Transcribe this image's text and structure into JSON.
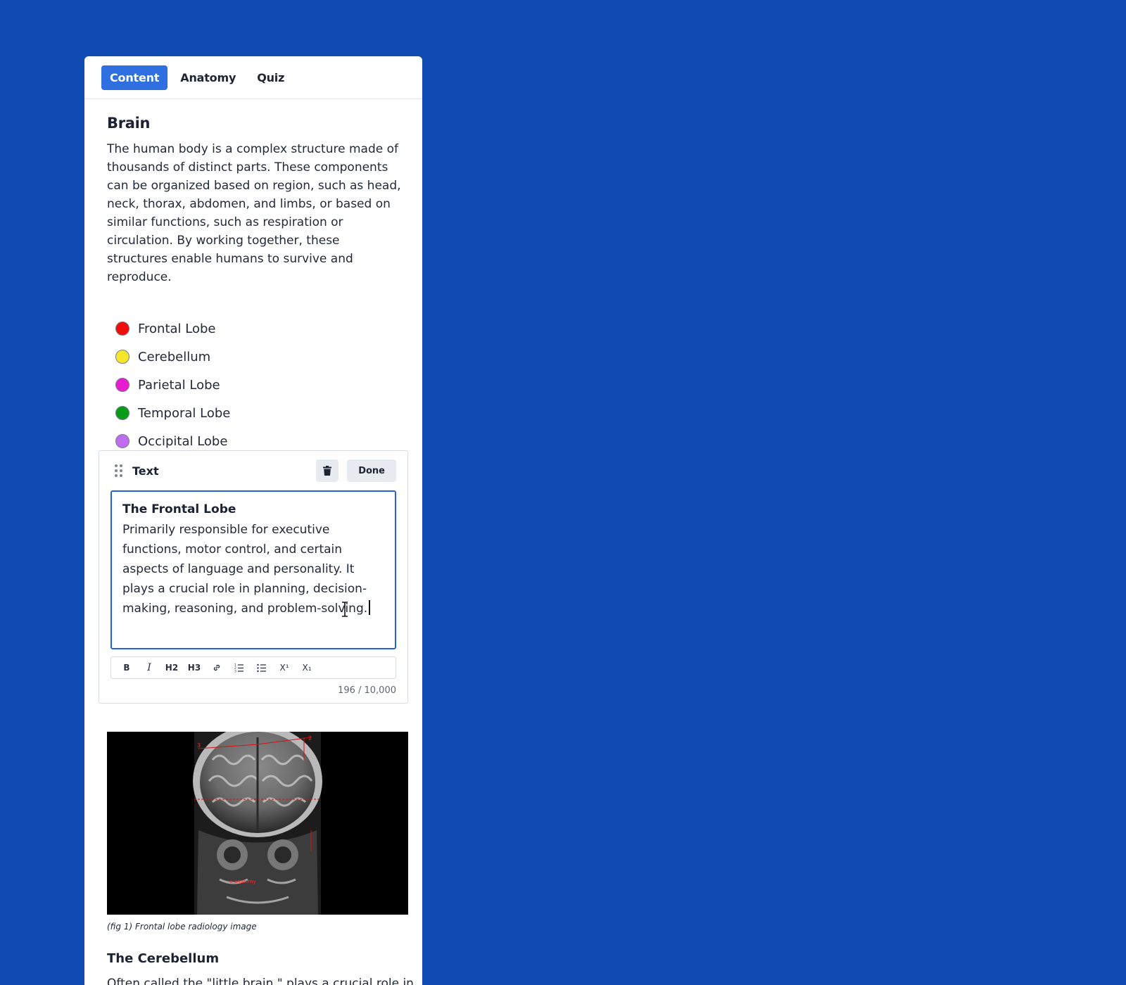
{
  "tabs": [
    {
      "label": "Content",
      "active": true
    },
    {
      "label": "Anatomy",
      "active": false
    },
    {
      "label": "Quiz",
      "active": false
    }
  ],
  "section": {
    "title": "Brain",
    "intro": "The human body is a complex structure made of thousands of distinct parts. These components can be organized based on region, such as head, neck, thorax, abdomen, and limbs, or based on similar functions, such as respiration or circulation. By working together, these structures enable humans to survive and reproduce."
  },
  "legend": [
    {
      "label": "Frontal Lobe",
      "color": "#f20d0d"
    },
    {
      "label": "Cerebellum",
      "color": "#f5e62a"
    },
    {
      "label": "Parietal Lobe",
      "color": "#e81ccf"
    },
    {
      "label": "Temporal Lobe",
      "color": "#0a9b1a"
    },
    {
      "label": "Occipital Lobe",
      "color": "#c06cf0"
    }
  ],
  "editor": {
    "block_type": "Text",
    "done_label": "Done",
    "heading": "The Frontal Lobe",
    "body": "Primarily responsible for executive functions, motor control, and certain aspects of language and personality. It plays a crucial role in planning, decision-making, reasoning, and problem-solving.",
    "toolbar": [
      "B",
      "I",
      "H2",
      "H3",
      "link",
      "ordered-list",
      "bullet-list",
      "X¹",
      "X₁"
    ],
    "char_count": "196 / 10,000"
  },
  "figure": {
    "caption": "(fig 1) Frontal lobe radiology image",
    "annotations": [
      "3",
      "2"
    ],
    "watermark": "e-anatomy"
  },
  "next_section": {
    "title": "The Cerebellum",
    "text": "Often called the \"little brain,\" plays a crucial role in"
  }
}
